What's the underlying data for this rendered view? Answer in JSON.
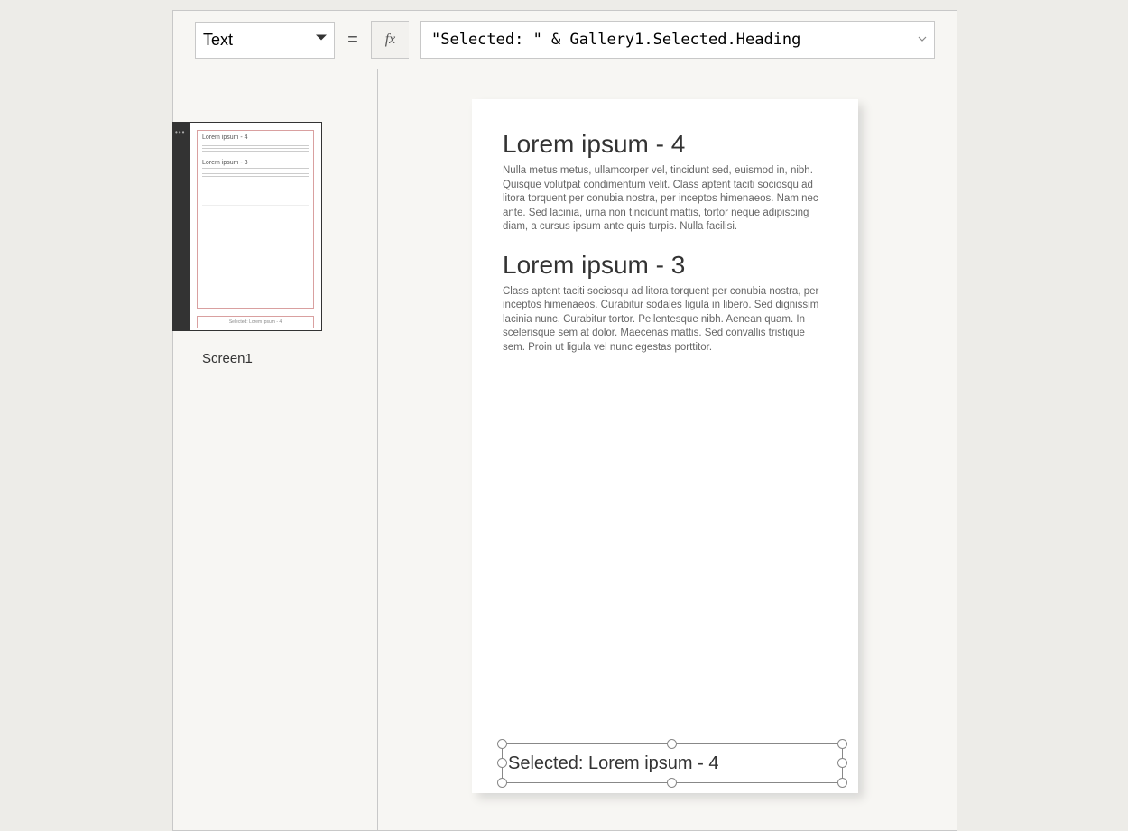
{
  "formula_bar": {
    "property": "Text",
    "fx_label": "fx",
    "equals": "=",
    "formula": "\"Selected: \" & Gallery1.Selected.Heading"
  },
  "left_panel": {
    "screen_label": "Screen1",
    "thumb": {
      "h1": "Lorem ipsum - 4",
      "h2": "Lorem ipsum - 3",
      "sel": "Selected: Lorem ipsum - 4"
    }
  },
  "canvas": {
    "gallery": [
      {
        "heading": "Lorem ipsum - 4",
        "body": "Nulla metus metus, ullamcorper vel, tincidunt sed, euismod in, nibh. Quisque volutpat condimentum velit. Class aptent taciti sociosqu ad litora torquent per conubia nostra, per inceptos himenaeos. Nam nec ante. Sed lacinia, urna non tincidunt mattis, tortor neque adipiscing diam, a cursus ipsum ante quis turpis. Nulla facilisi."
      },
      {
        "heading": "Lorem ipsum - 3",
        "body": "Class aptent taciti sociosqu ad litora torquent per conubia nostra, per inceptos himenaeos. Curabitur sodales ligula in libero. Sed dignissim lacinia nunc. Curabitur tortor. Pellentesque nibh. Aenean quam. In scelerisque sem at dolor. Maecenas mattis. Sed convallis tristique sem. Proin ut ligula vel nunc egestas porttitor."
      }
    ],
    "selected_label": "Selected: Lorem ipsum - 4"
  }
}
